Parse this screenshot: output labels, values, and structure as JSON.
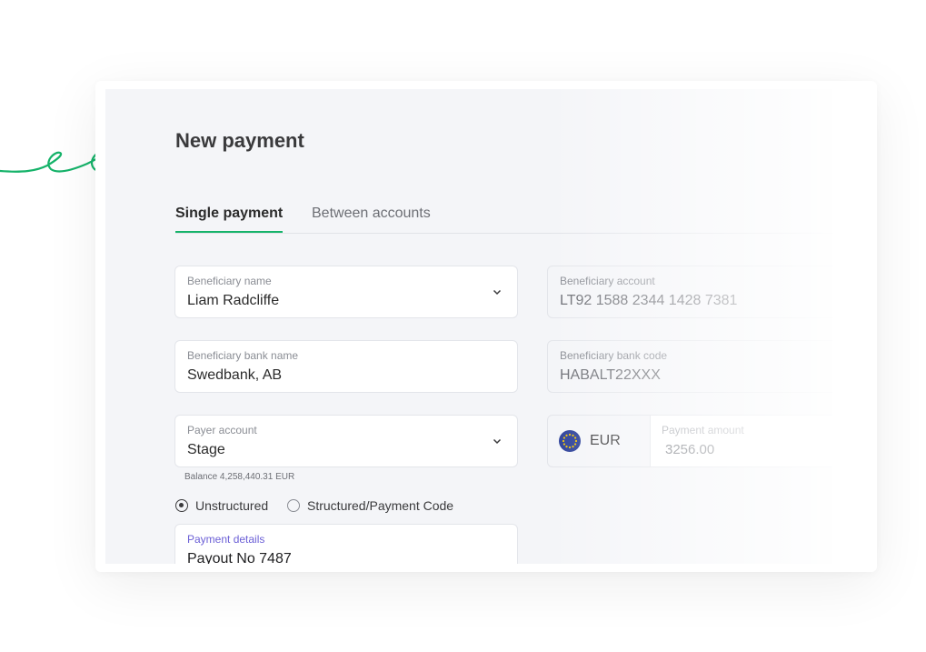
{
  "page": {
    "title": "New payment"
  },
  "tabs": [
    {
      "label": "Single payment",
      "active": true
    },
    {
      "label": "Between accounts",
      "active": false
    }
  ],
  "form": {
    "beneficiary_name": {
      "label": "Beneficiary name",
      "value": "Liam Radcliffe"
    },
    "beneficiary_account": {
      "label": "Beneficiary account",
      "value": "LT92 1588 2344 1428 7381"
    },
    "beneficiary_bank_name": {
      "label": "Beneficiary bank name",
      "value": "Swedbank, AB"
    },
    "beneficiary_bank_code": {
      "label": "Beneficiary bank code",
      "value": "HABALT22XXX"
    },
    "payer_account": {
      "label": "Payer account",
      "value": "Stage",
      "balance": "Balance 4,258,440.31 EUR"
    },
    "currency": {
      "code": "EUR",
      "flag_icon": "eu-flag-icon"
    },
    "payment_amount": {
      "label": "Payment amount",
      "value": "3256.00"
    },
    "details_type": {
      "options": [
        {
          "label": "Unstructured",
          "selected": true
        },
        {
          "label": "Structured/Payment Code",
          "selected": false
        }
      ]
    },
    "payment_details": {
      "label": "Payment details",
      "value": "Payout No 7487"
    }
  },
  "colors": {
    "accent": "#16b36a",
    "panel_bg": "#f4f5f8",
    "details_label": "#6b5fd6",
    "eu_blue": "#2a3f99",
    "eu_star": "#f2c300"
  }
}
